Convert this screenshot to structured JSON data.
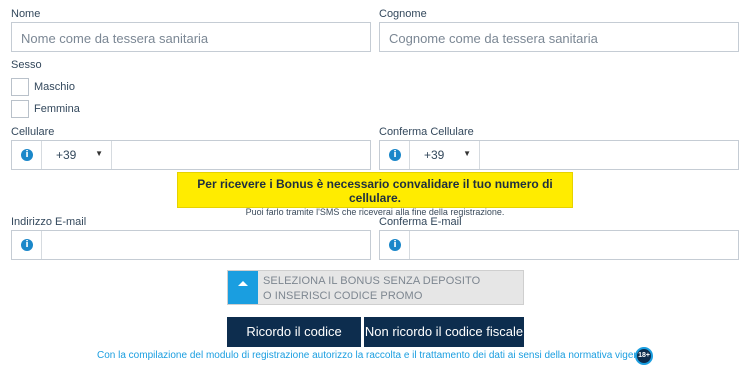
{
  "nome": {
    "label": "Nome",
    "placeholder": "Nome come da tessera sanitaria"
  },
  "cognome": {
    "label": "Cognome",
    "placeholder": "Cognome come da tessera sanitaria"
  },
  "sesso": {
    "label": "Sesso",
    "options": [
      "Maschio",
      "Femmina"
    ]
  },
  "cellulare": {
    "label": "Cellulare",
    "prefix": "+39",
    "value": ""
  },
  "conferma_cellulare": {
    "label": "Conferma Cellulare",
    "prefix": "+39",
    "value": ""
  },
  "notice": {
    "title": "Per ricevere i Bonus è necessario convalidare il tuo numero di cellulare.",
    "subtitle": "Puoi farlo tramite l'SMS che riceverai alla fine della registrazione."
  },
  "email": {
    "label": "Indirizzo E-mail",
    "value": ""
  },
  "conferma_email": {
    "label": "Conferma E-mail",
    "value": ""
  },
  "bonus": {
    "line1": "SELEZIONA IL BONUS SENZA DEPOSITO",
    "line2": "O INSERISCI CODICE PROMO"
  },
  "buttons": {
    "ricordo": "Ricordo il codice fiscale",
    "non_ricordo": "Non ricordo il codice fiscale"
  },
  "consent": "Con la compilazione del modulo di registrazione autorizzo la raccolta e il trattamento dei dati ai sensi della normativa vigente.",
  "age_badge": "18+",
  "info_glyph": "i",
  "colors": {
    "accent": "#1a9ee0",
    "button": "#0d2d4e",
    "notice": "#ffec00"
  }
}
